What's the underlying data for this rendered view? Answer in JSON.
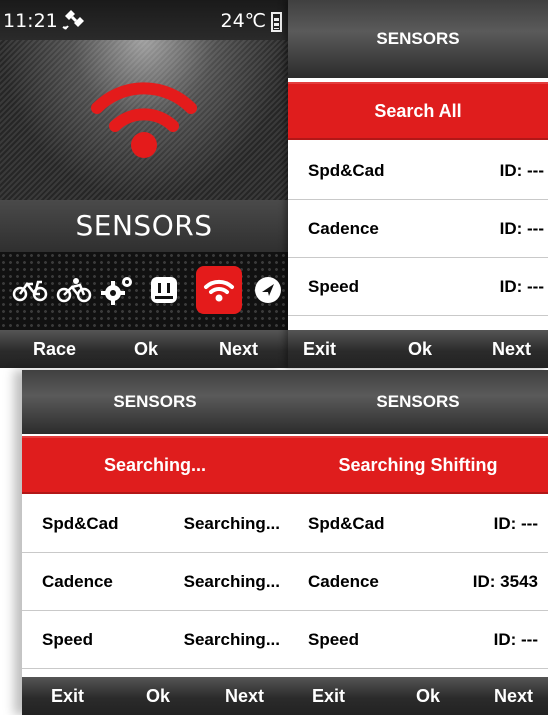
{
  "screens": {
    "main": {
      "status": {
        "time": "11:21",
        "temperature": "24℃",
        "gps_icon": "satellite-icon",
        "battery_icon": "battery-icon"
      },
      "hero_icon": "wifi-icon",
      "title": "SENSORS",
      "menu_icons": [
        "bike-icon",
        "road-bike-icon",
        "gears-icon",
        "device-icon",
        "wifi-icon",
        "navigation-icon"
      ],
      "active_icon": "wifi-icon",
      "accent": "#e41b1b",
      "softkeys": {
        "left": "Race",
        "center": "Ok",
        "right": "Next"
      }
    },
    "sensors_list": {
      "title": "SENSORS",
      "action": "Search All",
      "rows": [
        {
          "name": "Spd&Cad",
          "value": "ID: ---"
        },
        {
          "name": "Cadence",
          "value": "ID: ---"
        },
        {
          "name": "Speed",
          "value": "ID: ---"
        }
      ],
      "softkeys": {
        "left": "Exit",
        "center": "Ok",
        "right": "Next"
      }
    },
    "searching": {
      "title": "SENSORS",
      "action": "Searching...",
      "rows": [
        {
          "name": "Spd&Cad",
          "value": "Searching..."
        },
        {
          "name": "Cadence",
          "value": "Searching..."
        },
        {
          "name": "Speed",
          "value": "Searching..."
        }
      ],
      "softkeys": {
        "left": "Exit",
        "center": "Ok",
        "right": "Next"
      }
    },
    "shifting": {
      "title": "SENSORS",
      "action": "Searching Shifting",
      "rows": [
        {
          "name": "Spd&Cad",
          "value": "ID: ---"
        },
        {
          "name": "Cadence",
          "value": "ID: 3543"
        },
        {
          "name": "Speed",
          "value": "ID: ---"
        }
      ],
      "softkeys": {
        "left": "Exit",
        "center": "Ok",
        "right": "Next"
      }
    }
  }
}
